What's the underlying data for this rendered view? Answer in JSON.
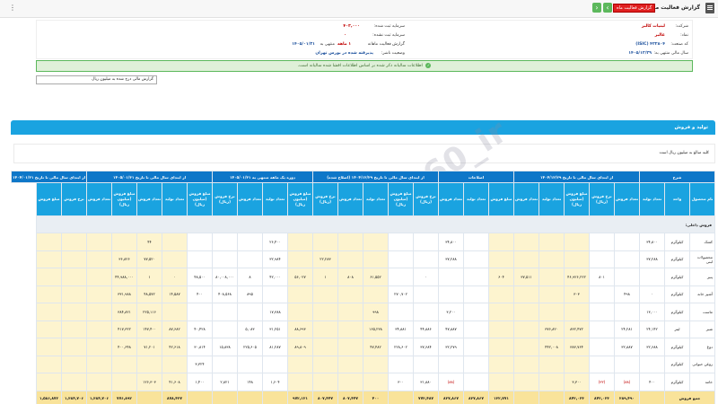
{
  "topbar": {
    "title": "گزارش فعالیت ماهانه",
    "badge": "گزارش فعالیت ماه",
    "prev": "‹",
    "next": "›",
    "menu": "⋮"
  },
  "company": {
    "company_label": "شرکت:",
    "company_value": "لبنیات کالبر",
    "symbol_label": "نماد:",
    "symbol_value": "غالبر",
    "code_label": "کد صنعت:",
    "code_value": "۴۲۲۸۰۴ (ISIC)",
    "fiscal_label": "سال مالی منتهی به:",
    "fiscal_value": "۱۴۰۵/۱۲/۲۹",
    "capital_label": "سرمایه ثبت شده:",
    "capital_value": "۴۰۳,۰۰۰",
    "unreg_label": "سرمایه ثبت نشده:",
    "unreg_value": "۰",
    "report_label": "گزارش فعالیت ماهانه",
    "report_month": "۱ ماهه",
    "report_end": "منتهی به",
    "report_date": "۱۴۰۵/۰۱/۳۱",
    "status_label": "وضعیت ناشر:",
    "status_value": "پذیرفته شده در بورس تهران"
  },
  "alert": "اطلاعات سالیانه ذکر شده بر اساس اطلاعات افشا شده سالیانه است.",
  "select": "گزارش مالی درج شده به میلیون ریال",
  "section": "تولید و فروش",
  "note": "کلیه مبالغ به میلیون ریال است",
  "groups": [
    {
      "label": "شرح",
      "span": 3
    },
    {
      "label": "از ابتدای سال مالی تا تاریخ ۱۴۰۴/۱۲/۲۹",
      "span": 5
    },
    {
      "label": "اصلاحات",
      "span": 3
    },
    {
      "label": "از ابتدای سال مالی تا تاریخ ۱۴۰۴/۱۲/۲۹ (اصلاح شده)",
      "span": 5
    },
    {
      "label": "دوره یک ماهه منتهی به ۱۴۰۵/۰۱/۳۱",
      "span": 4
    },
    {
      "label": "از ابتدای سال مالی تا تاریخ ۱۴۰۵/۰۱/۳۱",
      "span": 5
    },
    {
      "label": "از ابتدای سال مالی تا تاریخ ۱۴۰۴/۰۱/۳۱",
      "span": 3
    }
  ],
  "headers": [
    "نام محصول",
    "واحد",
    "تعداد تولید",
    "تعداد فروش",
    "نرخ فروش (ریال)",
    "مبلغ فروش (میلیون ریال)",
    "تعداد تولید",
    "تعداد فروش",
    "مبلغ فروش",
    "تعداد تولید",
    "تعداد فروش",
    "نرخ فروش (ریال)",
    "مبلغ فروش (میلیون ریال)",
    "تعداد تولید",
    "تعداد فروش",
    "نرخ فروش (ریال)",
    "مبلغ فروش (میلیون ریال)",
    "تعداد تولید",
    "تعداد فروش",
    "نرخ فروش (ریال)",
    "مبلغ فروش (میلیون ریال)",
    "تعداد تولید",
    "تعداد فروش",
    "مبلغ فروش (میلیون ریال)",
    "تعداد فروش",
    "نرخ فروش",
    "مبلغ فروش"
  ],
  "category": "فروش داخلی:",
  "rows": [
    {
      "cells": [
        "کشک",
        "کیلوگرم",
        "۳۴,۸۰۰",
        "",
        "",
        "",
        "",
        "",
        "",
        "",
        "۳۴,۸۰۰",
        "",
        "",
        "",
        "",
        "",
        "",
        "۲۶,۴۰۰",
        "",
        "",
        "",
        "",
        "۴۴",
        "",
        "",
        ""
      ]
    },
    {
      "cells": [
        "محصولات لبنی",
        "کیلوگرم",
        "۳۷,۲۸۸",
        "",
        "",
        "",
        "",
        "",
        "",
        "",
        "۳۷,۲۸۸",
        "",
        "",
        "",
        "",
        "۲۲,۲۸۳",
        "",
        "۳۲,۹۸۴",
        "",
        "",
        "",
        "",
        "۷۷,۵۲۰",
        "۳۶,۸۲۶",
        "",
        ""
      ]
    },
    {
      "cells": [
        "پنیر",
        "کیلوگرم",
        "",
        "",
        "۸۰۱",
        "۴۶,۹۲۶,۲۲۲",
        "",
        "۳۷,۵۱۱",
        "۶۰۴",
        "",
        "",
        "۰",
        "",
        "۶۱,۵۵۲",
        "۸۰۸",
        "۱",
        "۵۶,۰۲۷",
        "۴۲,۰۰۰",
        "۸",
        "۸۰,۰۰۸,۰۰۰",
        "۴۸,۵۰۰",
        "۰",
        "۱",
        "۴۴,۹۸۸,۰۰۰"
      ]
    },
    {
      "cells": [
        "آشپز خانه",
        "کیلوگرم",
        "۰",
        "۴۹۸",
        "",
        "۳۰۳",
        "",
        "",
        "",
        "",
        "",
        "",
        "۲۷۰,۷۰۲",
        "",
        "",
        "",
        "",
        "",
        "۸۹۵",
        "۴۰۸,۵۶۸",
        "۴۰۰",
        "۱۴,۵۸۷",
        "۴۸,۵۷۲",
        "۳۳۱,۹۸۸"
      ]
    },
    {
      "cells": [
        "ماست",
        "کیلوگرم",
        "۱۳,۰۰۰",
        "",
        "",
        "",
        "",
        "",
        "",
        "",
        "۳,۲۰۰",
        "",
        "",
        "۹۹۸",
        "",
        "",
        "",
        "۱۷,۳۸۸",
        "",
        "",
        "",
        "",
        "۲۲۵,۱۱۶",
        "۳۸۴,۸۲۱",
        ""
      ]
    },
    {
      "cells": [
        "شیر",
        "لیتر",
        "۲۴,۱۴۲",
        "۲۴,۲۸۱",
        "",
        "۸۳۲,۴۷۲",
        "۳۷۶,۸۲۰",
        "",
        "",
        "",
        "۴۷,۸۸۷",
        "۴۴,۸۸۶",
        "۳۴,۸۸۱",
        "۱۶۵,۲۳۸",
        "",
        "",
        "۸۸,۶۹۳",
        "۳۱,۲۵۱",
        "۵,۰۸۳",
        "",
        "۴۰,۴۲۸",
        "۸۷,۶۸۲",
        "۱۴۷,۴۰۰",
        "۴۱۷,۳۲۲"
      ]
    },
    {
      "cells": [
        "دوغ",
        "کیلوگرم",
        "۳۲,۶۸۸",
        "۳۲,۸۸۷",
        "",
        "۳۸۳,۷۶۴",
        "۴۴۲,۰۰۸",
        "",
        "",
        "",
        "۳۲,۲۷۹",
        "۳۷,۶۸۴",
        "۲۲۸,۶۰۲",
        "۴۷,۴۸۲",
        "",
        "",
        "۸۹,۸۰۹",
        "۸۱,۲۸۷",
        "۲۲۵,۶۰۵",
        "۱۵,۸۳۸",
        "۳۰,۸۱۴",
        "۴۲,۶۱۸",
        "۷۱,۲۰۱",
        "۴۰۰,۶۴۸"
      ]
    },
    {
      "cells": [
        "روغن حیوانی",
        "کیلوگرم",
        "",
        "",
        "",
        "",
        "",
        "",
        "",
        "",
        "",
        "",
        "",
        "",
        "",
        "",
        "",
        "",
        "",
        "",
        "۳,۳۲۴",
        "",
        "",
        ""
      ]
    },
    {
      "cells": [
        "خامه",
        "کیلوگرم",
        "۴۰۰",
        "(۸۸)",
        "(۳۲)",
        "۳,۳۰۰",
        "",
        "",
        "",
        "",
        "(۸۸)",
        "۳۱,۸۸۰",
        "۳۰۰",
        "",
        "",
        "",
        "",
        "۱,۶۰۴",
        "۱۴۸",
        "۲,۸۲۱",
        "۱,۴۰۰",
        "۴۱,۶۰۸",
        "۱۲۶,۳۰۳",
        ""
      ]
    }
  ],
  "total": {
    "label": "جمع فروش",
    "cells": [
      "۳۸۹,۴۹۰",
      "۸۴۲,۰۳۳",
      "",
      "۱۳۲,۷۷۱",
      "۸۲۷,۸۶۷",
      "۷۷۲,۴۸۷",
      "۴۰۰",
      "۸۰۷,۴۴۷",
      "۹۷۲,۱۲۱",
      "",
      "",
      "۸۷۸,۴۳۷",
      "۷۷۶,۸۹۲",
      "۱,۳۸۴,۷۰۶",
      "۱,۵۸۶,۸۷۲"
    ]
  }
}
